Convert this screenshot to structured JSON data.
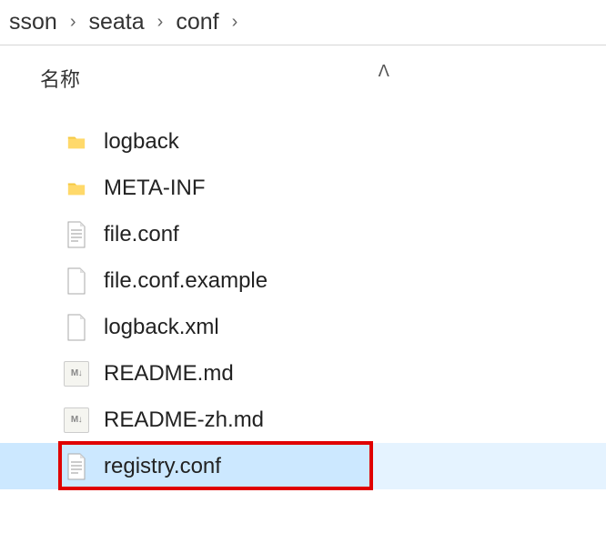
{
  "breadcrumb": {
    "items": [
      "sson",
      "seata",
      "conf"
    ],
    "separator": "›"
  },
  "columnHeader": {
    "name": "名称",
    "sortIndicator": "ᐱ"
  },
  "files": [
    {
      "name": "logback",
      "iconType": "folder",
      "selected": false
    },
    {
      "name": "META-INF",
      "iconType": "folder",
      "selected": false
    },
    {
      "name": "file.conf",
      "iconType": "textfile",
      "selected": false
    },
    {
      "name": "file.conf.example",
      "iconType": "blankfile",
      "selected": false
    },
    {
      "name": "logback.xml",
      "iconType": "blankfile",
      "selected": false
    },
    {
      "name": "README.md",
      "iconType": "md",
      "selected": false
    },
    {
      "name": "README-zh.md",
      "iconType": "md",
      "selected": false
    },
    {
      "name": "registry.conf",
      "iconType": "textfile",
      "selected": true,
      "highlighted": true
    }
  ],
  "iconLabels": {
    "md": "M↓"
  }
}
